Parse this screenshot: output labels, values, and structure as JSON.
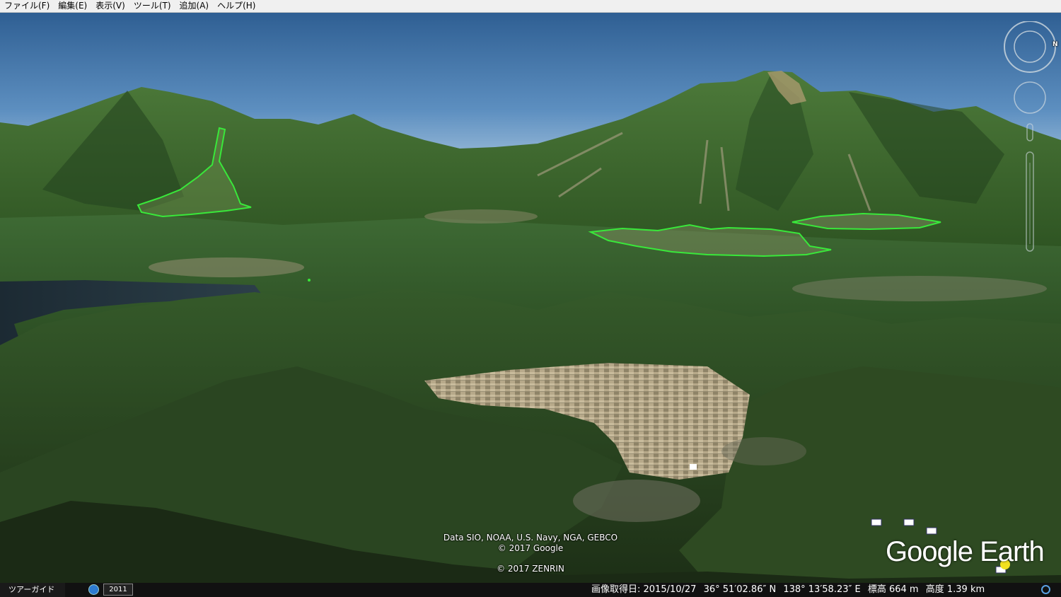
{
  "menubar": {
    "items": [
      "ファイル(F)",
      "編集(E)",
      "表示(V)",
      "ツール(T)",
      "追加(A)",
      "ヘルプ(H)"
    ]
  },
  "viewport": {
    "attribution": {
      "line1": "Data SIO, NOAA, U.S. Navy, NGA, GEBCO",
      "line2": "© 2017 Google",
      "line3": "© 2017 ZENRIN"
    },
    "logo": "Google Earth",
    "overlay_color": "#39e83a"
  },
  "navigation": {
    "compass_north": "N",
    "icons": [
      "compass-icon",
      "look-joystick-icon",
      "pegman-icon",
      "zoom-slider-icon"
    ]
  },
  "bottombar": {
    "tour_guide": "ツアーガイド",
    "year": "2011",
    "status": {
      "imagery_date": "画像取得日: 2015/10/27",
      "latitude": "36° 51′02.86″ N",
      "longitude": "138° 13′58.23″ E",
      "elevation": "標高 664 m",
      "altitude": "高度 1.39 km"
    }
  }
}
